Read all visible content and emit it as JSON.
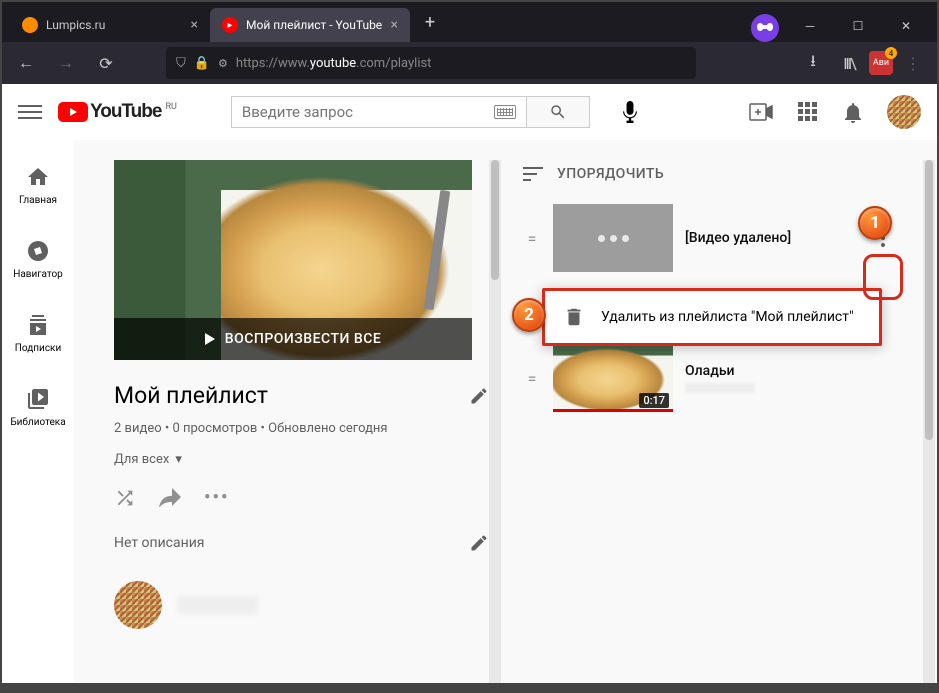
{
  "browser": {
    "tabs": [
      {
        "label": "Lumpics.ru",
        "active": false
      },
      {
        "label": "Мой плейлист - YouTube",
        "active": true
      }
    ],
    "url_prefix": "https://www.",
    "url_domain": "youtube",
    "url_path": ".com/playlist"
  },
  "youtube": {
    "logo_text": "YouTube",
    "region": "RU",
    "search_placeholder": "Введите запрос",
    "sidebar": [
      {
        "label": "Главная"
      },
      {
        "label": "Навигатор"
      },
      {
        "label": "Подписки"
      },
      {
        "label": "Библиотека"
      }
    ]
  },
  "playlist": {
    "hero_overlay": "ВОСПРОИЗВЕСТИ ВСЕ",
    "title": "Мой плейлист",
    "meta": "2 видео • 0 просмотров • Обновлено сегодня",
    "privacy": "Для всех",
    "description": "Нет описания",
    "sort_label": "УПОРЯДОЧИТЬ"
  },
  "videos": [
    {
      "title": "[Видео удалено]",
      "deleted": true
    },
    {
      "title": "Оладьи",
      "duration": "0:17",
      "deleted": false
    }
  ],
  "context_menu": {
    "remove": "Удалить из плейлиста \"Мой плейлист\""
  },
  "annotations": {
    "one": "1",
    "two": "2"
  }
}
